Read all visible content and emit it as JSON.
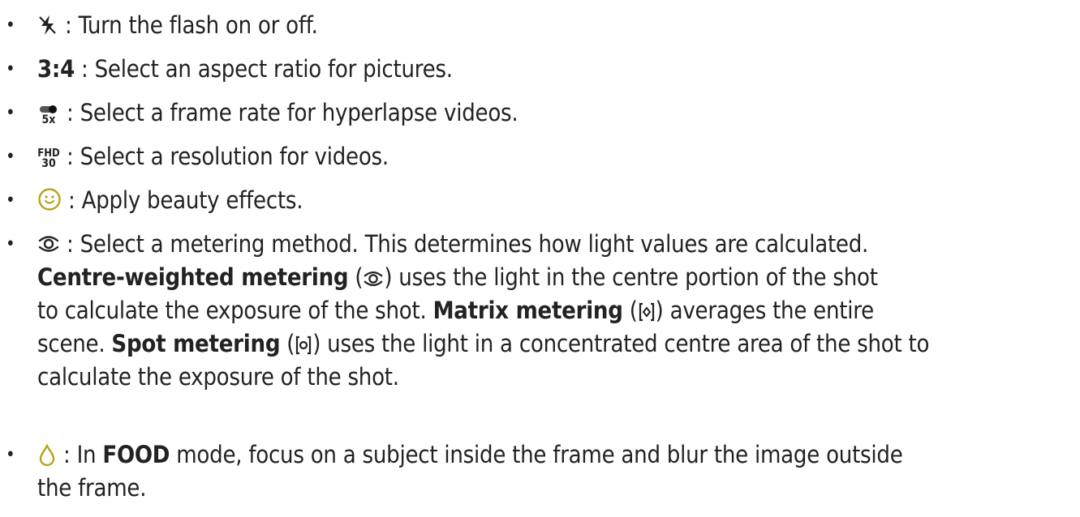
{
  "items": [
    {
      "icon": "flash-off-icon",
      "text": " : Turn the flash on or off."
    },
    {
      "icon_text": "3:4",
      "text": " : Select an aspect ratio for pictures."
    },
    {
      "icon": "hyperlapse-frame-rate-icon",
      "icon_caption": "5x",
      "text": " : Select a frame rate for hyperlapse videos."
    },
    {
      "icon": "video-resolution-icon",
      "icon_caption_top": "FHD",
      "icon_caption_bottom": "30",
      "text": " : Select a resolution for videos."
    },
    {
      "icon": "beauty-face-icon",
      "text": " : Apply beauty effects."
    },
    {
      "icon": "metering-icon",
      "text_1": " : Select a metering method. This determines how light values are calculated.",
      "term_1": "Centre-weighted metering",
      "text_2a": " (",
      "text_2b": ") uses the light in the centre portion of the shot",
      "text_3a": "to calculate the exposure of the shot. ",
      "term_2": "Matrix metering",
      "text_3b": " (",
      "text_3c": ") averages the entire",
      "text_4a": "scene. ",
      "term_3": "Spot metering",
      "text_4b": " (",
      "text_4c": ") uses the light in a concentrated centre area of the shot to",
      "text_5": "calculate the exposure of the shot."
    },
    {
      "icon": "food-focus-icon",
      "text_1": " : In ",
      "term": "FOOD",
      "text_2": " mode, focus on a subject inside the frame and blur the image outside",
      "text_3": "the frame."
    }
  ],
  "colors": {
    "text": "#222222",
    "beauty_icon": "#b8a41a",
    "food_icon": "#b8a41a"
  }
}
